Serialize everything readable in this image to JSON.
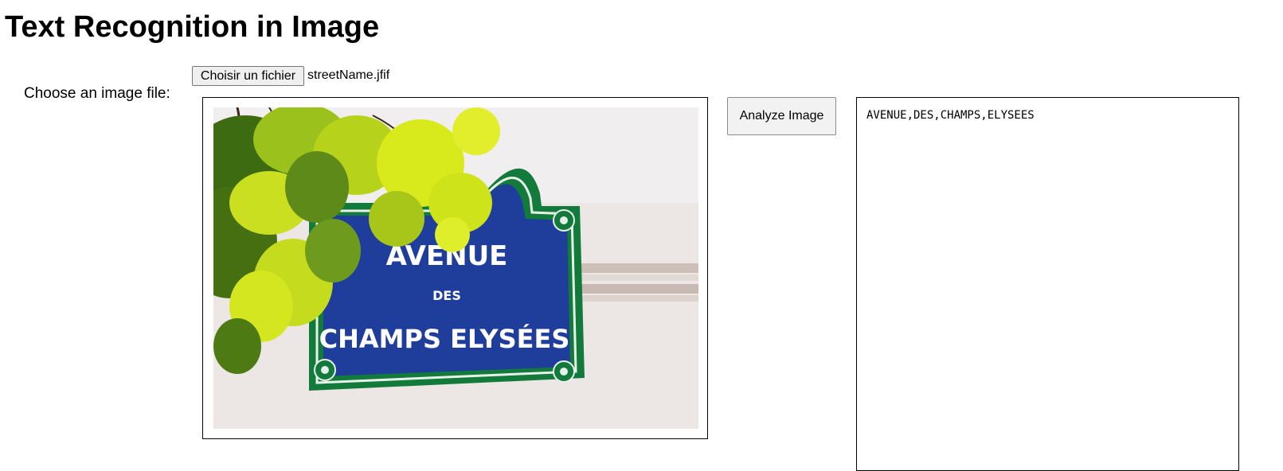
{
  "page": {
    "title": "Text Recognition in Image"
  },
  "file_input": {
    "label": "Choose an image file:",
    "button_label": "Choisir un fichier",
    "file_name": "streetName.jfif"
  },
  "preview": {
    "sign_line_1": "AVENUE",
    "sign_line_2": "DES",
    "sign_line_3": "CHAMPS ELYSÉES"
  },
  "analyze": {
    "button_label": "Analyze Image"
  },
  "result": {
    "text": "AVENUE,DES,CHAMPS,ELYSEES"
  },
  "colors": {
    "sign_blue": "#1f3d9a",
    "sign_green": "#127a3a",
    "leaf_yellow": "#d8ea1c",
    "leaf_green": "#6e9b1e",
    "wall": "#ece6e4"
  }
}
